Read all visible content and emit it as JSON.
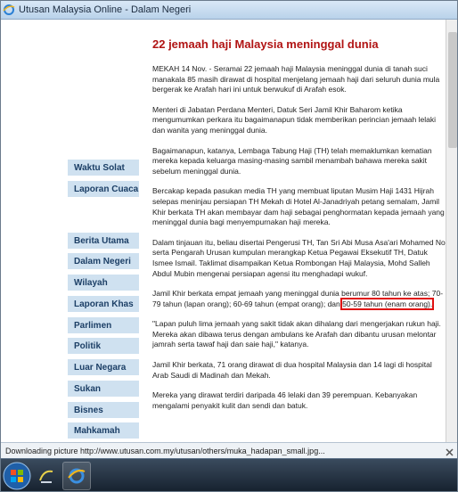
{
  "window": {
    "title": "Utusan Malaysia Online - Dalam Negeri"
  },
  "sidebar": {
    "top_items": [
      {
        "label": "Waktu Solat"
      },
      {
        "label": "Laporan Cuaca"
      }
    ],
    "items": [
      {
        "label": "Berita Utama"
      },
      {
        "label": "Dalam Negeri"
      },
      {
        "label": "Wilayah"
      },
      {
        "label": "Laporan Khas"
      },
      {
        "label": "Parlimen"
      },
      {
        "label": "Politik"
      },
      {
        "label": "Luar Negara"
      },
      {
        "label": "Sukan"
      },
      {
        "label": "Bisnes"
      },
      {
        "label": "Mahkamah"
      }
    ]
  },
  "article": {
    "headline": "22 jemaah haji Malaysia meninggal dunia",
    "paragraphs": [
      "MEKAH 14 Nov. - Seramai 22 jemaah haji Malaysia meninggal dunia di tanah suci manakala 85 masih dirawat di hospital menjelang jemaah haji dari seluruh dunia mula bergerak ke Arafah hari ini untuk berwukuf di Arafah esok.",
      "Menteri di Jabatan Perdana Menteri, Datuk Seri Jamil Khir Baharom ketika mengumumkan perkara itu bagaimanapun tidak memberikan perincian jemaah lelaki dan wanita yang meninggal dunia.",
      "Bagaimanapun, katanya, Lembaga Tabung Haji (TH) telah memaklumkan kematian mereka kepada keluarga masing-masing sambil menambah bahawa mereka sakit sebelum meninggal dunia.",
      "Bercakap kepada pasukan media TH yang membuat liputan Musim Haji 1431 Hijrah selepas meninjau persiapan TH Mekah di Hotel Al-Janadriyah petang semalam, Jamil Khir berkata TH akan membayar dam haji sebagai penghormatan kepada jemaah yang meninggal dunia bagi menyempurnakan haji mereka.",
      "Dalam tinjauan itu, beliau disertai Pengerusi TH, Tan Sri Abi Musa Asa'ari Mohamed Nor serta Pengarah Urusan kumpulan merangkap Ketua Pegawai Eksekutif TH, Datuk Ismee Ismail. Taklimat disampaikan Ketua Rombongan Haji Malaysia, Mohd Salleh Abdul Mubin mengenai persiapan agensi itu menghadapi wukuf."
    ],
    "age_para_before": "Jamil Khir berkata empat jemaah yang meninggal dunia berumur 80 tahun ke atas; 70-79 tahun (lapan orang); 60-69 tahun (empat orang); dan ",
    "age_para_highlight": "50-59 tahun (enam orang).",
    "paragraphs_after": [
      "\"Lapan puluh lima jemaah yang sakit tidak akan dihalang dari mengerjakan rukun haji. Mereka akan dibawa terus dengan ambulans ke Arafah dan dibantu urusan melontar jamrah serta tawaf haji dan saie haji,\" katanya.",
      "Jamil Khir berkata, 71 orang dirawat di dua hospital Malaysia dan 14 lagi di hospital Arab Saudi di Madinah dan Mekah.",
      "Mereka yang dirawat terdiri daripada 46 lelaki dan 39 perempuan. Kebanyakan mengalami penyakit kulit dan sendi dan batuk."
    ]
  },
  "status_bar": {
    "text": "Downloading picture http://www.utusan.com.my/utusan/others/muka_hadapan_small.jpg..."
  },
  "colors": {
    "headline": "#b11414",
    "nav_bg": "#cfe1f0",
    "nav_text": "#1c3f66",
    "highlight_box": "#e01111"
  },
  "icons": {
    "title_icon": "ie-icon",
    "taskbar": [
      "windows-start-icon",
      "app-icon",
      "ie-icon"
    ]
  }
}
